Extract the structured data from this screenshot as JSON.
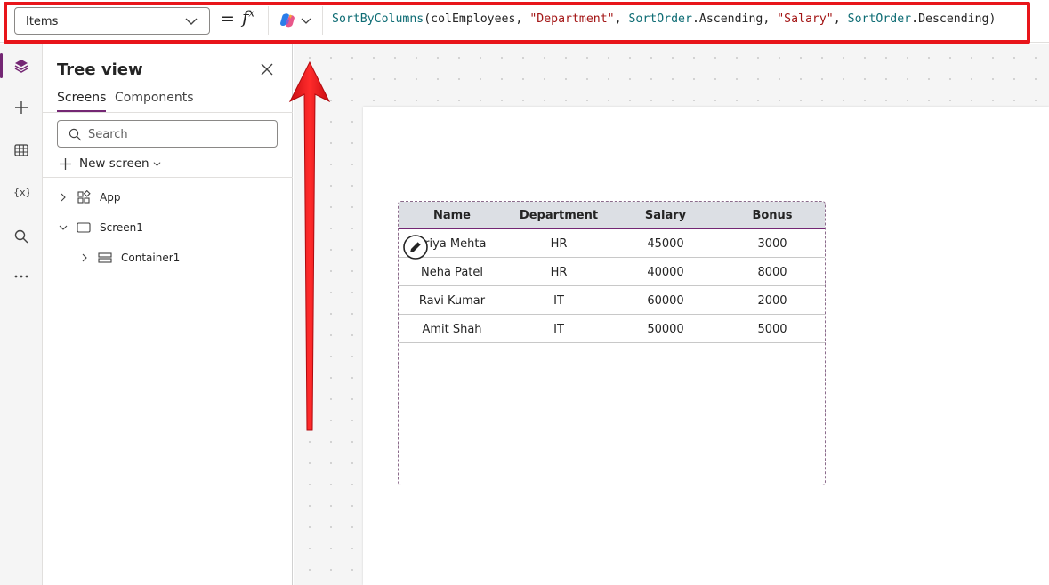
{
  "formula_bar": {
    "property": "Items",
    "equals": "=",
    "fx": "f",
    "fx_sup": "x",
    "formula": {
      "fn": "SortByColumns",
      "arg1": "(colEmployees, ",
      "str1": "\"Department\"",
      "sep1": ", ",
      "enum1": "SortOrder",
      "val1": ".Ascending, ",
      "str2": "\"Salary\"",
      "sep2": ", ",
      "enum2": "SortOrder",
      "val2": ".Descending)"
    }
  },
  "tree_view": {
    "title": "Tree view",
    "tabs": [
      "Screens",
      "Components"
    ],
    "search_placeholder": "Search",
    "new_screen": "New screen",
    "nodes": [
      "App",
      "Screen1",
      "Container1"
    ]
  },
  "table": {
    "columns": [
      "Name",
      "Department",
      "Salary",
      "Bonus"
    ],
    "rows": [
      [
        "Priya Mehta",
        "HR",
        "45000",
        "3000"
      ],
      [
        "Neha Patel",
        "HR",
        "40000",
        "8000"
      ],
      [
        "Ravi Kumar",
        "IT",
        "60000",
        "2000"
      ],
      [
        "Amit Shah",
        "IT",
        "50000",
        "5000"
      ]
    ]
  },
  "colors": {
    "accent": "#742774",
    "highlight": "#e8151a"
  }
}
